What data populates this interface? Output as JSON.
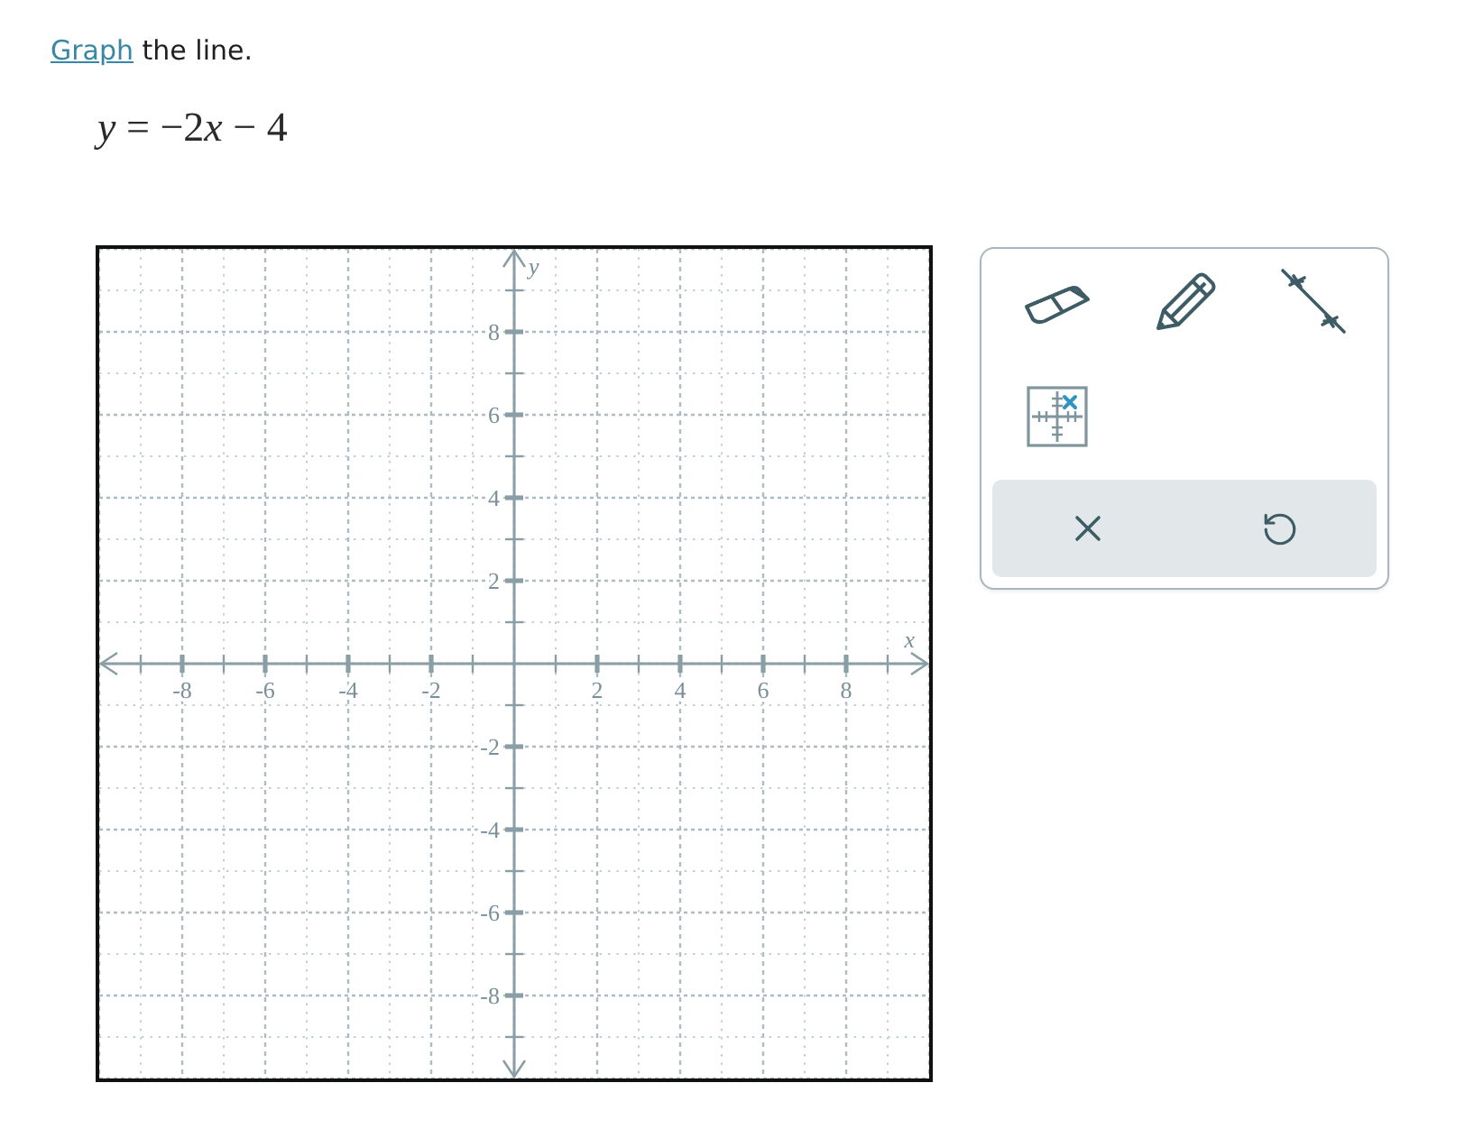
{
  "instruction": {
    "link": "Graph",
    "text": "the line."
  },
  "equation": [
    {
      "kind": "variable",
      "text": "y"
    },
    {
      "kind": "text",
      "text": " = −2"
    },
    {
      "kind": "variable",
      "text": "x"
    },
    {
      "kind": "text",
      "text": " − 4"
    }
  ],
  "graph": {
    "chart_data": {
      "type": "line",
      "xlabel": "x",
      "ylabel": "y",
      "xlim": [
        -10,
        10
      ],
      "ylim": [
        -10,
        10
      ],
      "xticks": [
        -8,
        -6,
        -4,
        -2,
        2,
        4,
        6,
        8
      ],
      "yticks": [
        -8,
        -6,
        -4,
        -2,
        2,
        4,
        6,
        8
      ],
      "grid": true
    }
  }
}
